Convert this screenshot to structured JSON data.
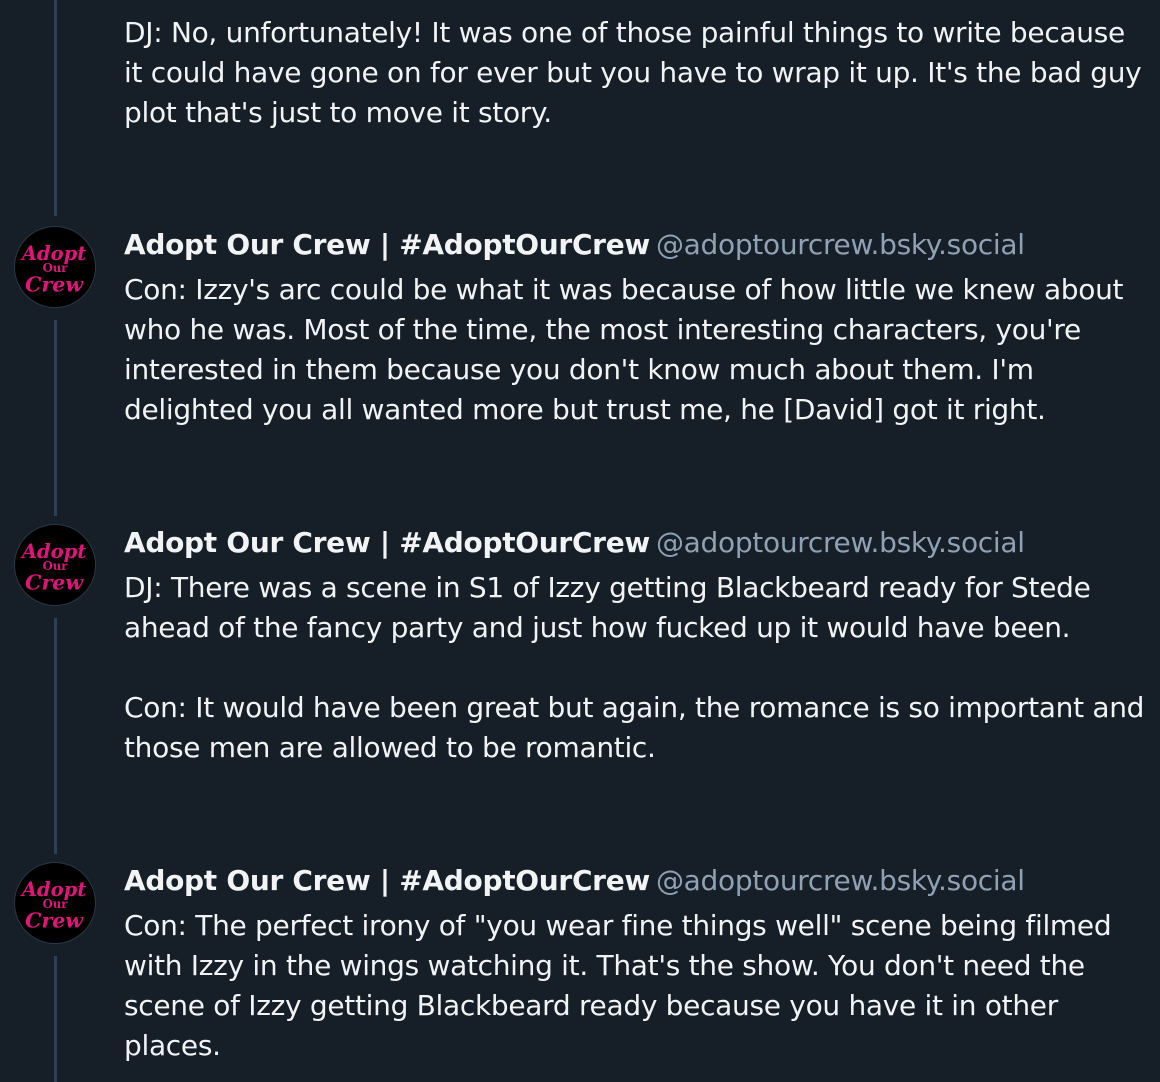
{
  "posts": [
    {
      "body": "DJ: No, unfortunately! It was one of those painful things to write because it could have gone on for ever but you have to wrap it up. It's the bad guy plot that's just to move it story."
    },
    {
      "author": {
        "display_name": "Adopt Our Crew | #AdoptOurCrew",
        "handle": "@adoptourcrew.bsky.social",
        "avatar_text": [
          "Adopt",
          "Our",
          "Crew"
        ],
        "avatar_color": "#e0147a"
      },
      "body": "Con: Izzy's arc could be what it was because of how little we knew about who he was. Most of the time, the most interesting characters, you're interested in them because you don't know much about them. I'm delighted you all wanted more but trust me, he [David] got it right."
    },
    {
      "author": {
        "display_name": "Adopt Our Crew | #AdoptOurCrew",
        "handle": "@adoptourcrew.bsky.social",
        "avatar_text": [
          "Adopt",
          "Our",
          "Crew"
        ],
        "avatar_color": "#e0147a"
      },
      "body": "DJ: There was a scene in S1 of Izzy getting Blackbeard ready for Stede ahead of the fancy party and just how fucked up it would have been.\n\nCon: It would have been great but again, the romance is so important and those men are allowed to be romantic."
    },
    {
      "author": {
        "display_name": "Adopt Our Crew | #AdoptOurCrew",
        "handle": "@adoptourcrew.bsky.social",
        "avatar_text": [
          "Adopt",
          "Our",
          "Crew"
        ],
        "avatar_color": "#e0147a"
      },
      "body": "Con: The perfect irony of \"you wear fine things well\" scene being filmed with Izzy in the wings watching it. That's the show. You don't need the scene of Izzy getting Blackbeard ready because you have it in other places."
    }
  ]
}
